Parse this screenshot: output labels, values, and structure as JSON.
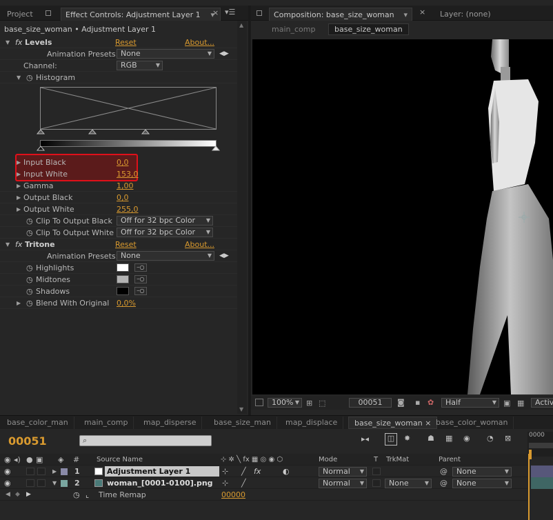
{
  "left_panel": {
    "tab_project": "Project",
    "tab_effect_controls": "Effect Controls: Adjustment Layer 1",
    "breadcrumb": "base_size_woman • Adjustment Layer 1",
    "levels": {
      "name": "Levels",
      "reset": "Reset",
      "about": "About...",
      "animation_presets_label": "Animation Presets:",
      "animation_presets_value": "None",
      "channel_label": "Channel:",
      "channel_value": "RGB",
      "histogram_label": "Histogram",
      "input_black_label": "Input Black",
      "input_black_value": "0,0",
      "input_white_label": "Input White",
      "input_white_value": "153,0",
      "gamma_label": "Gamma",
      "gamma_value": "1,00",
      "output_black_label": "Output Black",
      "output_black_value": "0,0",
      "output_white_label": "Output White",
      "output_white_value": "255,0",
      "clip_black_label": "Clip To Output Black",
      "clip_black_value": "Off for 32 bpc Color",
      "clip_white_label": "Clip To Output White",
      "clip_white_value": "Off for 32 bpc Color"
    },
    "tritone": {
      "name": "Tritone",
      "reset": "Reset",
      "about": "About...",
      "animation_presets_label": "Animation Presets:",
      "animation_presets_value": "None",
      "highlights_label": "Highlights",
      "midtones_label": "Midtones",
      "shadows_label": "Shadows",
      "blend_label": "Blend With Original",
      "blend_value": "0,0%",
      "highlights_color": "#ffffff",
      "midtones_color": "#b3b3b3",
      "shadows_color": "#000000"
    }
  },
  "viewer": {
    "tab_composition": "Composition: base_size_woman",
    "tab_layer": "Layer: (none)",
    "crumb_main": "main_comp",
    "crumb_current": "base_size_woman",
    "zoom": "100%",
    "frame": "00051",
    "resolution": "Half",
    "active_camera": "Activ"
  },
  "timeline": {
    "tabs": [
      "base_color_man",
      "main_comp",
      "map_disperse",
      "base_size_man",
      "map_displace",
      "base_size_woman",
      "base_color_woman"
    ],
    "current_time": "00051",
    "ruler_start": "0000",
    "headers": {
      "num": "#",
      "source_name": "Source Name",
      "mode": "Mode",
      "t": "T",
      "trkmat": "TrkMat",
      "parent": "Parent"
    },
    "layers": [
      {
        "index": "1",
        "name": "Adjustment Layer 1",
        "mode": "Normal",
        "trkmat": "",
        "parent": "None"
      },
      {
        "index": "2",
        "name": "woman_[0001-0100].png",
        "mode": "Normal",
        "trkmat": "None",
        "parent": "None"
      }
    ],
    "time_remap_label": "Time Remap",
    "time_remap_value": "00000"
  },
  "colors": {
    "accent_orange": "#d99a2f",
    "highlight_red": "#e0101a"
  }
}
